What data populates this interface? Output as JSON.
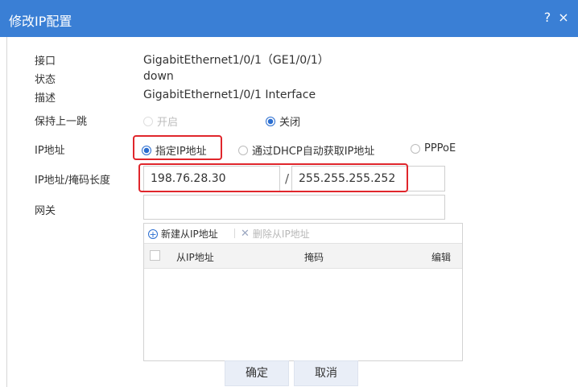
{
  "dialog": {
    "title": "修改IP配置",
    "help_icon": "?",
    "close_icon": "×"
  },
  "fields": {
    "interface_label": "接口",
    "interface_value": "GigabitEthernet1/0/1（GE1/0/1）",
    "status_label": "状态",
    "status_value": "down",
    "description_label": "描述",
    "description_value": "GigabitEthernet1/0/1 Interface",
    "keep_hop_label": "保持上一跳",
    "keep_hop_options": [
      "开启",
      "关闭"
    ],
    "keep_hop_selected": "关闭",
    "ip_label": "IP地址",
    "ip_options": [
      "指定IP地址",
      "通过DHCP自动获取IP地址",
      "PPPoE"
    ],
    "ip_selected": "指定IP地址",
    "ip_mask_label": "IP地址/掩码长度",
    "ip_value": "198.76.28.30",
    "slash": "/",
    "mask_value": "255.255.255.252",
    "gateway_label": "网关",
    "gateway_value": ""
  },
  "secondary_ip": {
    "add_button": "新建从IP地址",
    "delete_button": "删除从IP地址",
    "columns": [
      "从IP地址",
      "掩码",
      "编辑"
    ],
    "rows": []
  },
  "buttons": {
    "ok": "确定",
    "cancel": "取消"
  },
  "colors": {
    "titlebar": "#3a7fd5",
    "highlight": "#e0262c",
    "radio_accent": "#2a6dd0"
  }
}
